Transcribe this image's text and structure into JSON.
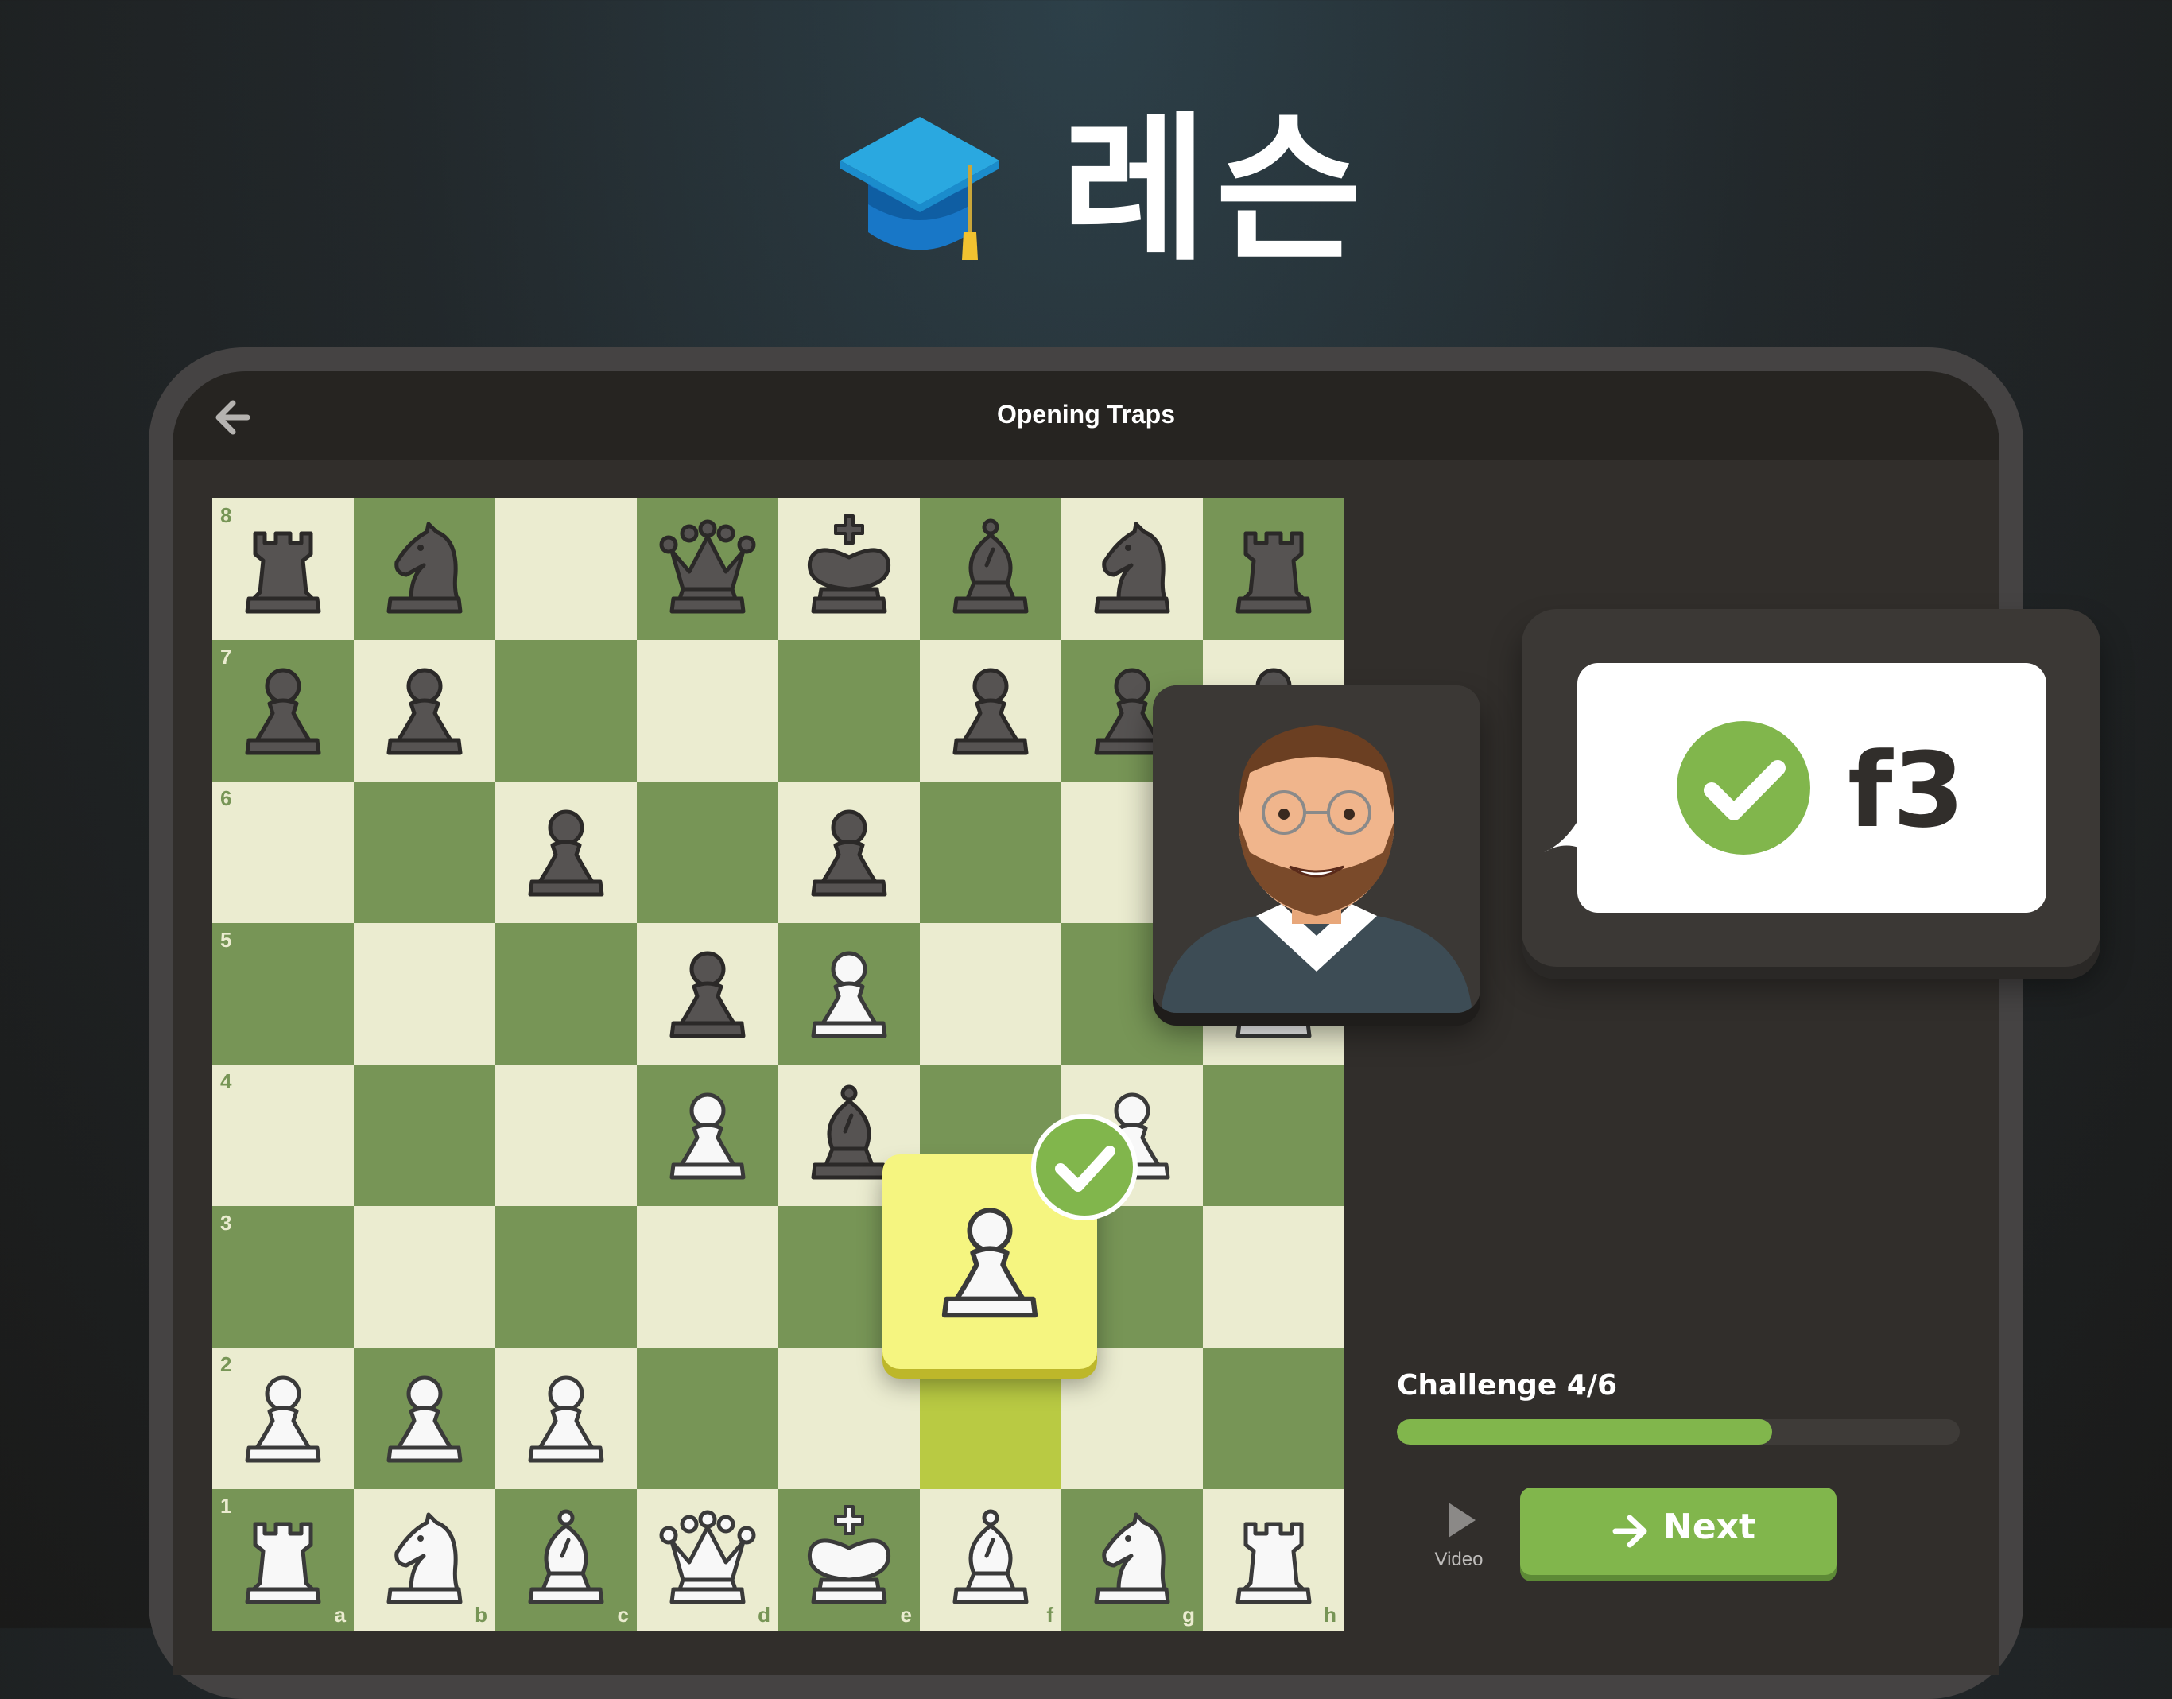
{
  "hero": {
    "title": "레슨",
    "icon": "graduation-cap-icon"
  },
  "screen": {
    "title": "Opening Traps",
    "back_icon": "arrow-left-icon"
  },
  "board": {
    "ranks": [
      "8",
      "7",
      "6",
      "5",
      "4",
      "3",
      "2",
      "1"
    ],
    "files": [
      "a",
      "b",
      "c",
      "d",
      "e",
      "f",
      "g",
      "h"
    ],
    "colors": {
      "light": "#ebecd0",
      "dark": "#779556",
      "highlight": "#b9ca43"
    },
    "pieces": [
      {
        "sq": "a8",
        "p": "bR"
      },
      {
        "sq": "b8",
        "p": "bN"
      },
      {
        "sq": "d8",
        "p": "bQ"
      },
      {
        "sq": "e8",
        "p": "bK"
      },
      {
        "sq": "f8",
        "p": "bB"
      },
      {
        "sq": "g8",
        "p": "bN"
      },
      {
        "sq": "h8",
        "p": "bR"
      },
      {
        "sq": "a7",
        "p": "bP"
      },
      {
        "sq": "b7",
        "p": "bP"
      },
      {
        "sq": "f7",
        "p": "bP"
      },
      {
        "sq": "g7",
        "p": "bP"
      },
      {
        "sq": "h7",
        "p": "bP"
      },
      {
        "sq": "c6",
        "p": "bP"
      },
      {
        "sq": "e6",
        "p": "bP"
      },
      {
        "sq": "d5",
        "p": "bP"
      },
      {
        "sq": "e5",
        "p": "wP"
      },
      {
        "sq": "h5",
        "p": "wP"
      },
      {
        "sq": "d4",
        "p": "wP"
      },
      {
        "sq": "e4",
        "p": "bB"
      },
      {
        "sq": "g4",
        "p": "wP"
      },
      {
        "sq": "a2",
        "p": "wP"
      },
      {
        "sq": "b2",
        "p": "wP"
      },
      {
        "sq": "c2",
        "p": "wP"
      },
      {
        "sq": "a1",
        "p": "wR"
      },
      {
        "sq": "b1",
        "p": "wN"
      },
      {
        "sq": "c1",
        "p": "wB"
      },
      {
        "sq": "d1",
        "p": "wQ"
      },
      {
        "sq": "e1",
        "p": "wK"
      },
      {
        "sq": "f1",
        "p": "wB"
      },
      {
        "sq": "g1",
        "p": "wN"
      },
      {
        "sq": "h1",
        "p": "wR"
      }
    ],
    "highlight_squares": [
      "f2"
    ],
    "moving_piece": "wP"
  },
  "coach": {
    "avatar": "coach-avatar",
    "move": "f3",
    "check_icon": "checkmark-icon"
  },
  "challenge": {
    "label": "Challenge 4/6",
    "progress": 0.6667
  },
  "controls": {
    "video_label": "Video",
    "video_icon": "play-icon",
    "next_label": "Next",
    "next_icon": "arrow-right-icon"
  },
  "accent": "#81b64c"
}
